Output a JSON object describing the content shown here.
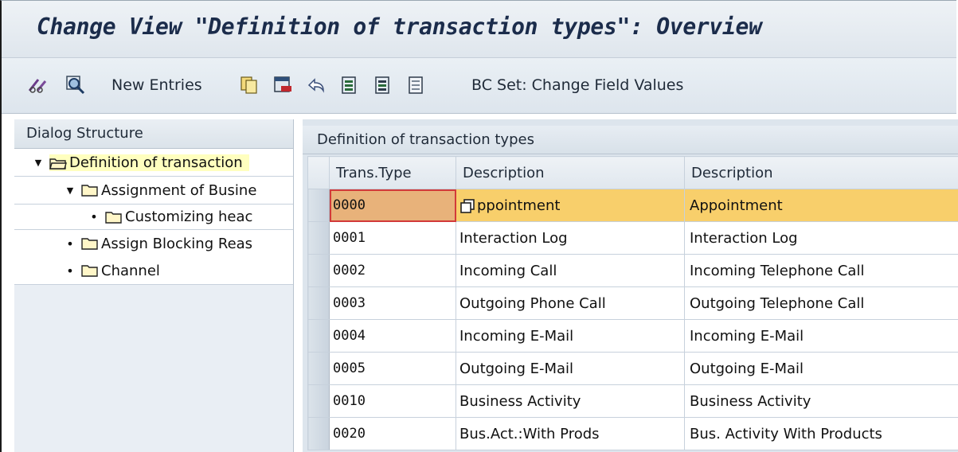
{
  "window": {
    "title": "Change View \"Definition of transaction types\": Overview"
  },
  "toolbar": {
    "new_entries_label": "New Entries",
    "bc_set_label": "BC Set: Change Field Values"
  },
  "dialog_structure": {
    "header": "Dialog Structure",
    "items": [
      {
        "label": "Definition of transaction",
        "expander": "expanded"
      },
      {
        "label": "Assignment of Busine",
        "expander": "expanded"
      },
      {
        "label": "Customizing heac",
        "expander": "leaf"
      },
      {
        "label": "Assign Blocking Reas",
        "expander": "leaf"
      },
      {
        "label": "Channel",
        "expander": "leaf"
      }
    ]
  },
  "table": {
    "title": "Definition of transaction types",
    "columns": [
      "Trans.Type",
      "Description",
      "Description"
    ],
    "rows": [
      {
        "code": "0000",
        "desc": "ppointment",
        "desc2": "Appointment"
      },
      {
        "code": "0001",
        "desc": "Interaction Log",
        "desc2": "Interaction Log"
      },
      {
        "code": "0002",
        "desc": "Incoming Call",
        "desc2": "Incoming Telephone Call"
      },
      {
        "code": "0003",
        "desc": "Outgoing Phone Call",
        "desc2": "Outgoing Telephone Call"
      },
      {
        "code": "0004",
        "desc": "Incoming E-Mail",
        "desc2": "Incoming E-Mail"
      },
      {
        "code": "0005",
        "desc": "Outgoing E-Mail",
        "desc2": "Outgoing E-Mail"
      },
      {
        "code": "0010",
        "desc": "Business Activity",
        "desc2": "Business Activity"
      },
      {
        "code": "0020",
        "desc": "Bus.Act.:With Prods",
        "desc2": "Bus. Activity With Products"
      }
    ]
  },
  "colors": {
    "selected_row": "#f8cf6b",
    "selected_cell": "#e8b27a",
    "tree_selected": "#ffffbf",
    "title_text": "#1b2c4b"
  }
}
